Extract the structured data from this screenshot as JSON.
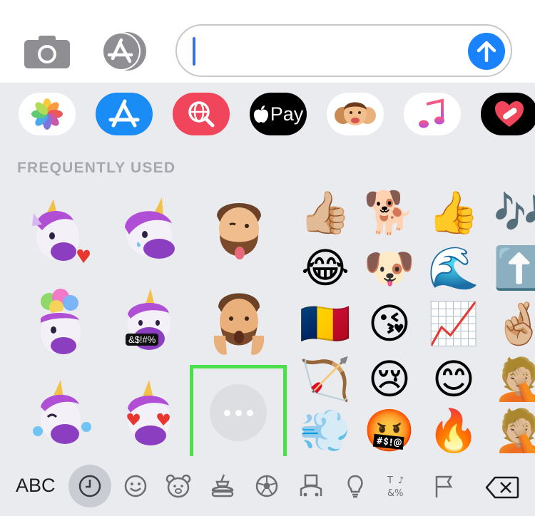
{
  "message_bar": {
    "text_value": "",
    "camera_icon": "camera-icon",
    "apps_icon": "app-store-icon",
    "send_icon": "arrow-up-icon",
    "accent": "#1a82fb"
  },
  "app_drawer": [
    {
      "name": "photos-app",
      "icon": "photos-icon",
      "bg": "#ffffff"
    },
    {
      "name": "app-store-app",
      "icon": "app-store-icon",
      "bg": "#1a8cf5"
    },
    {
      "name": "images-search-app",
      "icon": "globe-search-icon",
      "bg": "#f0455a"
    },
    {
      "name": "apple-pay-app",
      "label": "Pay",
      "icon": "apple-icon",
      "bg": "#000000"
    },
    {
      "name": "memoji-app",
      "icon": "memoji-icon",
      "bg": "#ffffff"
    },
    {
      "name": "music-app",
      "icon": "music-note-icon",
      "bg": "#ffffff"
    },
    {
      "name": "digital-touch-app",
      "icon": "heart-icon",
      "bg": "#000000"
    }
  ],
  "keyboard": {
    "section_title": "FREQUENTLY USED",
    "sticker_badge_text": "&$!#%",
    "emojis": [
      [
        "👍🏼",
        "🐕",
        "👍",
        "🎶"
      ],
      [
        "😂",
        "🐶",
        "🌊",
        "⬆️"
      ],
      [
        "🇹🇩",
        "😘",
        "📈",
        "🤞🏼"
      ],
      [
        "🏹",
        "😢",
        "😊",
        "🤦🏼"
      ],
      [
        "💨",
        "🤬",
        "🔥",
        "🤦🏼"
      ]
    ],
    "more_button": "more-icon"
  },
  "category_bar": {
    "abc_label": "ABC",
    "active": "recent",
    "categories": [
      "clock-icon",
      "smiley-icon",
      "bear-icon",
      "food-icon",
      "soccer-ball-icon",
      "building-icon",
      "lightbulb-icon",
      "symbols-icon",
      "flag-icon"
    ],
    "backspace": "backspace-icon"
  }
}
